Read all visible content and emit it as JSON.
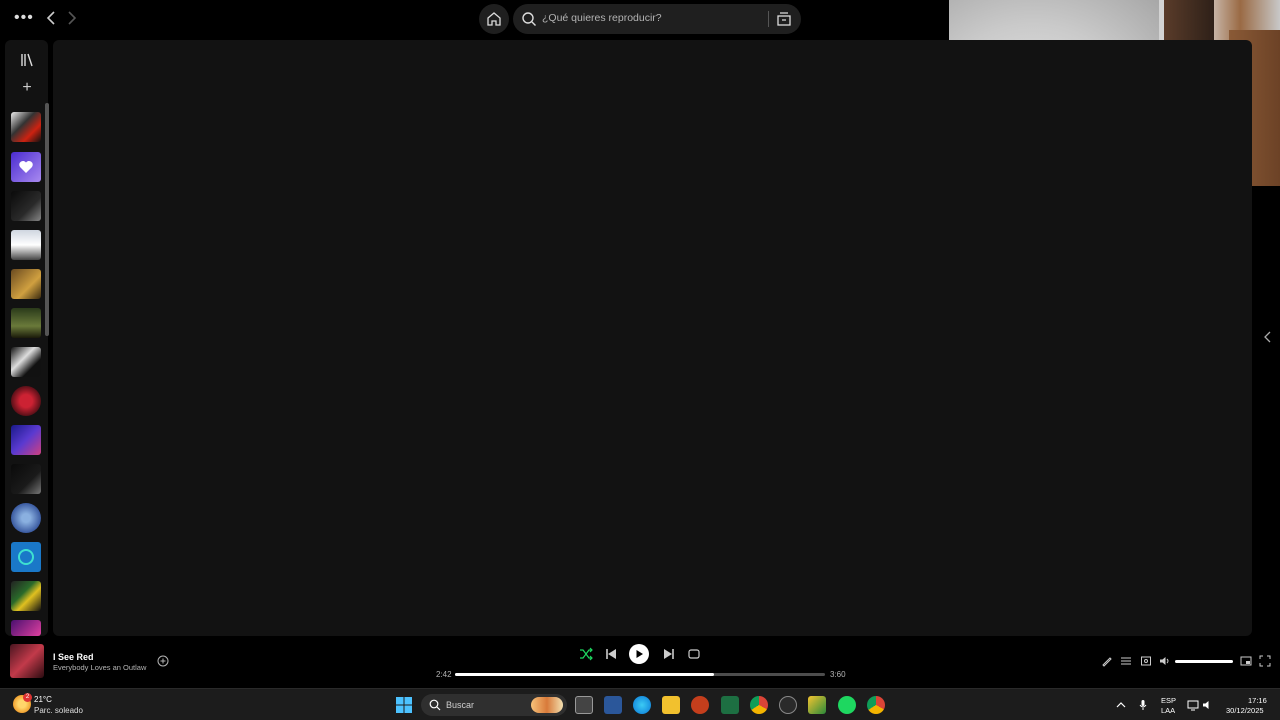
{
  "topbar": {
    "search_placeholder": "¿Qué quieres reproducir?"
  },
  "player": {
    "track_title": "I See Red",
    "track_artist": "Everybody Loves an Outlaw",
    "elapsed": "2:42",
    "duration": "3:60",
    "progress_fraction": 0.7,
    "volume_fraction": 1.0,
    "accent": "#1ed760"
  },
  "taskbar": {
    "weather_temp": "21°C",
    "weather_desc": "Parc. soleado",
    "weather_badge": "2",
    "search_label": "Buscar",
    "lang_top": "ESP",
    "lang_bottom": "LAA",
    "time": "17:16",
    "date": "30/12/2025"
  },
  "icons": {
    "library": "library-icon",
    "create": "plus-icon",
    "home": "home-icon",
    "search": "search-icon",
    "browse": "browse-icon"
  }
}
